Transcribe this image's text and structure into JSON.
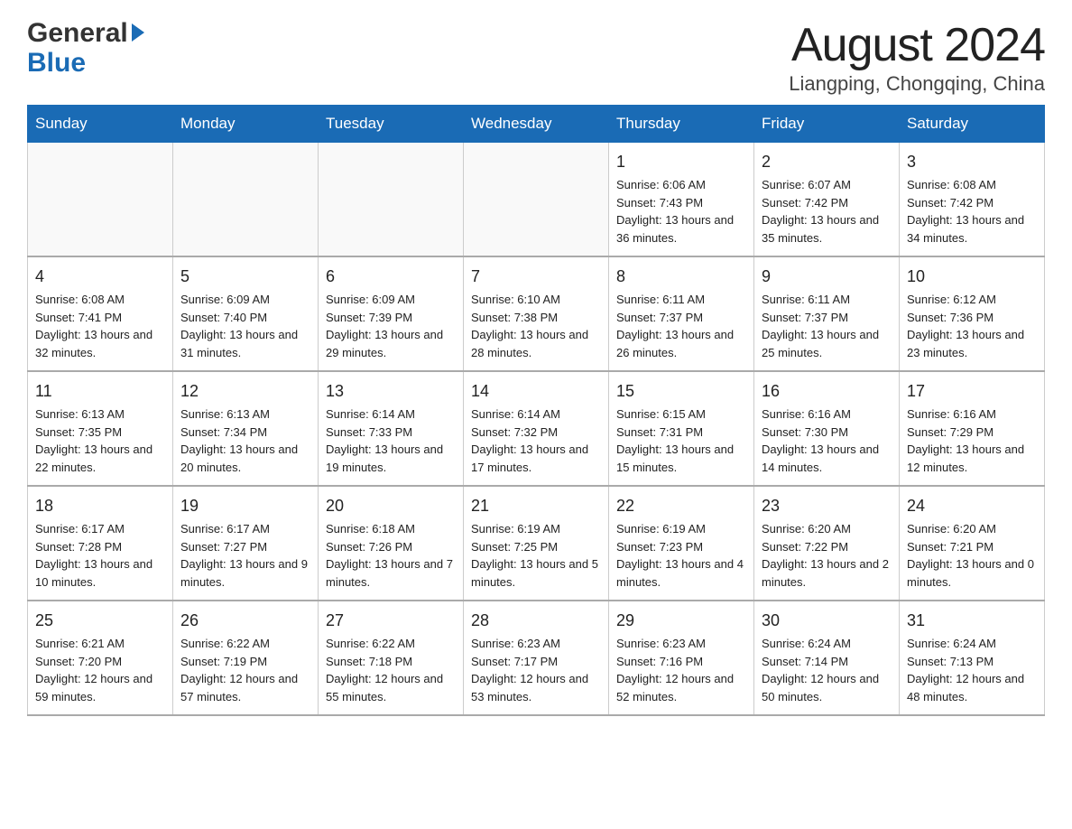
{
  "logo": {
    "general": "General",
    "blue": "Blue"
  },
  "title": "August 2024",
  "subtitle": "Liangping, Chongqing, China",
  "days_of_week": [
    "Sunday",
    "Monday",
    "Tuesday",
    "Wednesday",
    "Thursday",
    "Friday",
    "Saturday"
  ],
  "weeks": [
    [
      {
        "day": "",
        "info": ""
      },
      {
        "day": "",
        "info": ""
      },
      {
        "day": "",
        "info": ""
      },
      {
        "day": "",
        "info": ""
      },
      {
        "day": "1",
        "info": "Sunrise: 6:06 AM\nSunset: 7:43 PM\nDaylight: 13 hours and 36 minutes."
      },
      {
        "day": "2",
        "info": "Sunrise: 6:07 AM\nSunset: 7:42 PM\nDaylight: 13 hours and 35 minutes."
      },
      {
        "day": "3",
        "info": "Sunrise: 6:08 AM\nSunset: 7:42 PM\nDaylight: 13 hours and 34 minutes."
      }
    ],
    [
      {
        "day": "4",
        "info": "Sunrise: 6:08 AM\nSunset: 7:41 PM\nDaylight: 13 hours and 32 minutes."
      },
      {
        "day": "5",
        "info": "Sunrise: 6:09 AM\nSunset: 7:40 PM\nDaylight: 13 hours and 31 minutes."
      },
      {
        "day": "6",
        "info": "Sunrise: 6:09 AM\nSunset: 7:39 PM\nDaylight: 13 hours and 29 minutes."
      },
      {
        "day": "7",
        "info": "Sunrise: 6:10 AM\nSunset: 7:38 PM\nDaylight: 13 hours and 28 minutes."
      },
      {
        "day": "8",
        "info": "Sunrise: 6:11 AM\nSunset: 7:37 PM\nDaylight: 13 hours and 26 minutes."
      },
      {
        "day": "9",
        "info": "Sunrise: 6:11 AM\nSunset: 7:37 PM\nDaylight: 13 hours and 25 minutes."
      },
      {
        "day": "10",
        "info": "Sunrise: 6:12 AM\nSunset: 7:36 PM\nDaylight: 13 hours and 23 minutes."
      }
    ],
    [
      {
        "day": "11",
        "info": "Sunrise: 6:13 AM\nSunset: 7:35 PM\nDaylight: 13 hours and 22 minutes."
      },
      {
        "day": "12",
        "info": "Sunrise: 6:13 AM\nSunset: 7:34 PM\nDaylight: 13 hours and 20 minutes."
      },
      {
        "day": "13",
        "info": "Sunrise: 6:14 AM\nSunset: 7:33 PM\nDaylight: 13 hours and 19 minutes."
      },
      {
        "day": "14",
        "info": "Sunrise: 6:14 AM\nSunset: 7:32 PM\nDaylight: 13 hours and 17 minutes."
      },
      {
        "day": "15",
        "info": "Sunrise: 6:15 AM\nSunset: 7:31 PM\nDaylight: 13 hours and 15 minutes."
      },
      {
        "day": "16",
        "info": "Sunrise: 6:16 AM\nSunset: 7:30 PM\nDaylight: 13 hours and 14 minutes."
      },
      {
        "day": "17",
        "info": "Sunrise: 6:16 AM\nSunset: 7:29 PM\nDaylight: 13 hours and 12 minutes."
      }
    ],
    [
      {
        "day": "18",
        "info": "Sunrise: 6:17 AM\nSunset: 7:28 PM\nDaylight: 13 hours and 10 minutes."
      },
      {
        "day": "19",
        "info": "Sunrise: 6:17 AM\nSunset: 7:27 PM\nDaylight: 13 hours and 9 minutes."
      },
      {
        "day": "20",
        "info": "Sunrise: 6:18 AM\nSunset: 7:26 PM\nDaylight: 13 hours and 7 minutes."
      },
      {
        "day": "21",
        "info": "Sunrise: 6:19 AM\nSunset: 7:25 PM\nDaylight: 13 hours and 5 minutes."
      },
      {
        "day": "22",
        "info": "Sunrise: 6:19 AM\nSunset: 7:23 PM\nDaylight: 13 hours and 4 minutes."
      },
      {
        "day": "23",
        "info": "Sunrise: 6:20 AM\nSunset: 7:22 PM\nDaylight: 13 hours and 2 minutes."
      },
      {
        "day": "24",
        "info": "Sunrise: 6:20 AM\nSunset: 7:21 PM\nDaylight: 13 hours and 0 minutes."
      }
    ],
    [
      {
        "day": "25",
        "info": "Sunrise: 6:21 AM\nSunset: 7:20 PM\nDaylight: 12 hours and 59 minutes."
      },
      {
        "day": "26",
        "info": "Sunrise: 6:22 AM\nSunset: 7:19 PM\nDaylight: 12 hours and 57 minutes."
      },
      {
        "day": "27",
        "info": "Sunrise: 6:22 AM\nSunset: 7:18 PM\nDaylight: 12 hours and 55 minutes."
      },
      {
        "day": "28",
        "info": "Sunrise: 6:23 AM\nSunset: 7:17 PM\nDaylight: 12 hours and 53 minutes."
      },
      {
        "day": "29",
        "info": "Sunrise: 6:23 AM\nSunset: 7:16 PM\nDaylight: 12 hours and 52 minutes."
      },
      {
        "day": "30",
        "info": "Sunrise: 6:24 AM\nSunset: 7:14 PM\nDaylight: 12 hours and 50 minutes."
      },
      {
        "day": "31",
        "info": "Sunrise: 6:24 AM\nSunset: 7:13 PM\nDaylight: 12 hours and 48 minutes."
      }
    ]
  ]
}
